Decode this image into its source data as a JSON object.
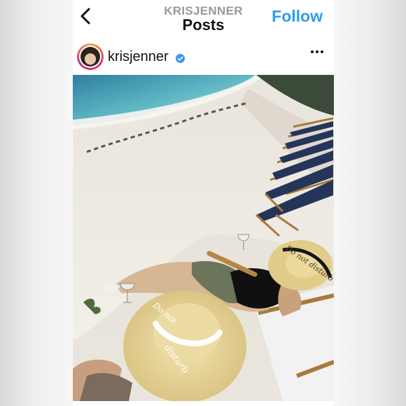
{
  "header": {
    "account_label": "KRISJENNER",
    "title": "Posts",
    "follow_label": "Follow",
    "back_icon": "chevron-left-icon"
  },
  "post": {
    "username": "krisjenner",
    "verified": true,
    "more_icon": "ellipsis-icon",
    "photo": {
      "hat_text_front": "Do not disturb",
      "hat_text_back": "Do not disturb"
    }
  },
  "colors": {
    "follow": "#2f9ee8",
    "verified_badge": "#3897f0",
    "header_sub": "#9a9a9a"
  }
}
